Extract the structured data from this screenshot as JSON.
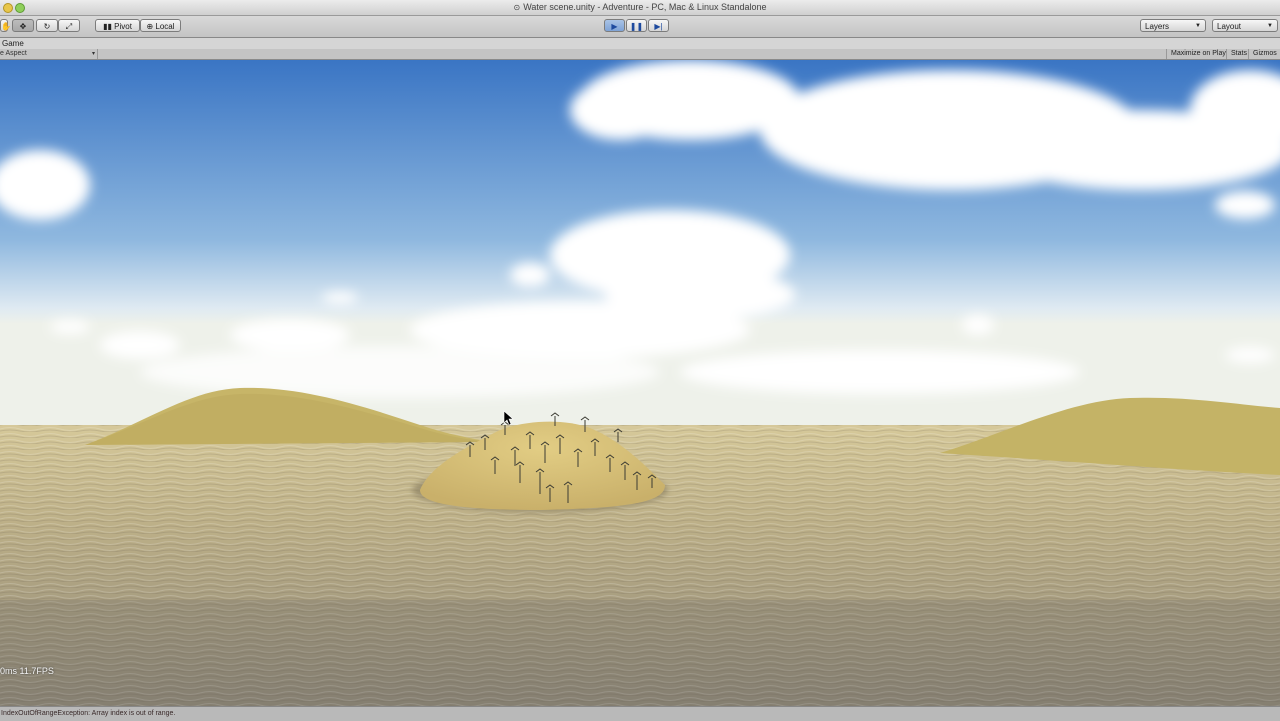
{
  "window": {
    "title": "Water scene.unity - Adventure - PC, Mac & Linux Standalone"
  },
  "toolbar": {
    "pivot_label": "Pivot",
    "local_label": "Local",
    "layers_label": "Layers",
    "layout_label": "Layout"
  },
  "game_view": {
    "tab_label": "Game",
    "aspect_label": "e Aspect",
    "maximize_label": "Maximize on Play",
    "stats_label": "Stats",
    "gizmos_label": "Gizmos",
    "fps_text": "0ms 11.7FPS"
  },
  "status": {
    "message": "IndexOutOfRangeException: Array index is out of range."
  },
  "colors": {
    "play_active": "#7fa3d6",
    "sky_top": "#3d78c6",
    "sky_horizon": "#dfeaf2",
    "sand": "#d8c27a",
    "water": "#b7ab86"
  }
}
